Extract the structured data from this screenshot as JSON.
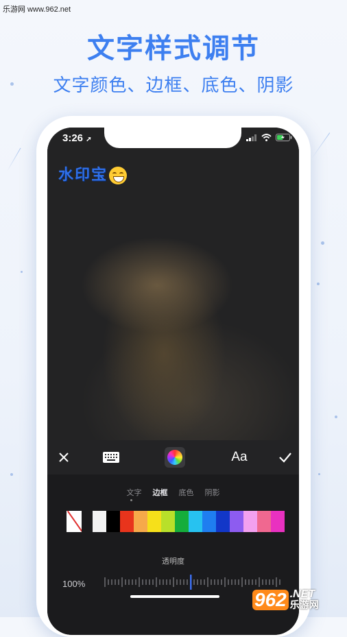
{
  "site_watermark": "乐游网 www.962.net",
  "headline": "文字样式调节",
  "subheadline": "文字颜色、边框、底色、阴影",
  "status_bar": {
    "time": "3:26"
  },
  "watermark_text": "水印宝",
  "toolbar": {
    "font_label": "Aa"
  },
  "style_tabs": [
    {
      "label": "文字",
      "active": false
    },
    {
      "label": "边框",
      "active": true
    },
    {
      "label": "底色",
      "active": false
    },
    {
      "label": "阴影",
      "active": false
    }
  ],
  "color_swatches": [
    "none",
    "#f2f2f2",
    "#000000",
    "#e8341c",
    "#f6a94a",
    "#f6e01a",
    "#b8e02a",
    "#15ad3b",
    "#27c2f0",
    "#1f7ef0",
    "#1237c8",
    "#8d5cf0",
    "#f3a0ef",
    "#f06890",
    "#e931c0"
  ],
  "opacity": {
    "label": "透明度",
    "value": "100%"
  },
  "logo": {
    "number": "962",
    "suffix": ".NET",
    "cn": "乐游网"
  },
  "colors": {
    "accent": "#3d7ff0",
    "watermark_blue": "#2f6fe8"
  }
}
